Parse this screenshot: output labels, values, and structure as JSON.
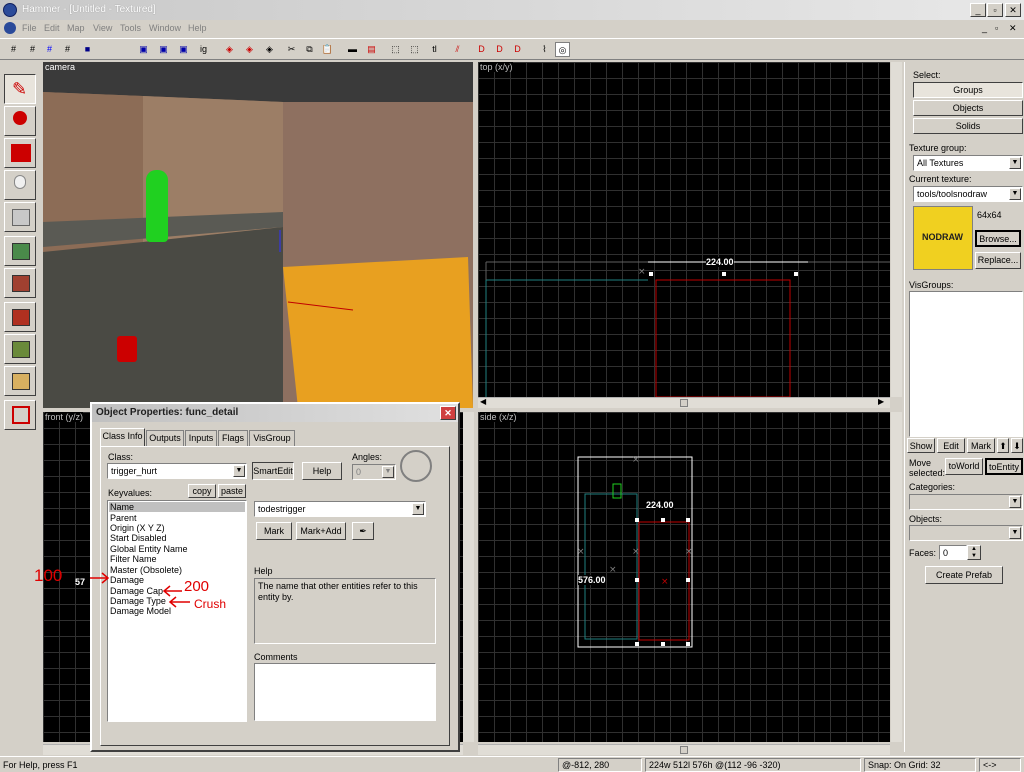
{
  "window": {
    "title": "Hammer - [Untitled - Textured]",
    "buttons": [
      "_",
      "▫",
      "✕"
    ]
  },
  "menu": [
    "File",
    "Edit",
    "Map",
    "View",
    "Tools",
    "Window",
    "Help"
  ],
  "viewports": {
    "camera": "camera",
    "top": "top (x/y)",
    "front": "front (y/z)",
    "side": "side (x/z)",
    "top_dimension": "224.00",
    "side_dimension_w": "224.00",
    "side_dimension_h": "576.00",
    "front_partial": "57"
  },
  "right_panel": {
    "select_label": "Select:",
    "groups": "Groups",
    "objects": "Objects",
    "solids": "Solids",
    "texture_group_label": "Texture group:",
    "texture_group_value": "All Textures",
    "current_texture_label": "Current texture:",
    "current_texture_value": "tools/toolsnodraw",
    "texture_size": "64x64",
    "texture_preview_text": "NODRAW",
    "browse": "Browse...",
    "replace": "Replace...",
    "visgroups_label": "VisGroups:",
    "show": "Show",
    "edit": "Edit",
    "mark": "Mark",
    "up": "⬆",
    "down": "⬇",
    "move_selected_label": "Move selected:",
    "to_world": "toWorld",
    "to_entity": "toEntity",
    "categories_label": "Categories:",
    "objects_label": "Objects:",
    "faces_label": "Faces:",
    "faces_value": "0",
    "create_prefab": "Create Prefab"
  },
  "dialog": {
    "title": "Object Properties: func_detail",
    "tabs": [
      "Class Info",
      "Outputs",
      "Inputs",
      "Flags",
      "VisGroup"
    ],
    "class_label": "Class:",
    "class_value": "trigger_hurt",
    "smartedit": "SmartEdit",
    "help": "Help",
    "angles_label": "Angles:",
    "angles_value": "0",
    "keyvalues_label": "Keyvalues:",
    "copy": "copy",
    "paste": "paste",
    "keyvalues": [
      "Name",
      "Parent",
      "Origin (X Y Z)",
      "Start Disabled",
      "Global Entity Name",
      "Filter Name",
      "Master (Obsolete)",
      "Damage",
      "Damage Cap",
      "Damage Type",
      "Damage Model"
    ],
    "value_field": "todestrigger",
    "mark": "Mark",
    "mark_add": "Mark+Add",
    "help_label": "Help",
    "help_text": "The name that other entities refer to this entity by.",
    "comments_label": "Comments"
  },
  "annotations": {
    "damage": "100",
    "damage_cap": "200",
    "damage_type": "Crush"
  },
  "status": {
    "help": "For Help, press F1",
    "coords": "@-812, 280",
    "selection": "224w 512l 576h @(112 -96 -320)",
    "snap": "Snap: On Grid: 32",
    "arrows": "<->"
  },
  "colors": {
    "title_gradient_start": "#0a246a",
    "title_gradient_end": "#a6caf0",
    "selection_red": "#c00000",
    "annotation_red": "#e00000",
    "nodraw_yellow": "#f0d020"
  }
}
